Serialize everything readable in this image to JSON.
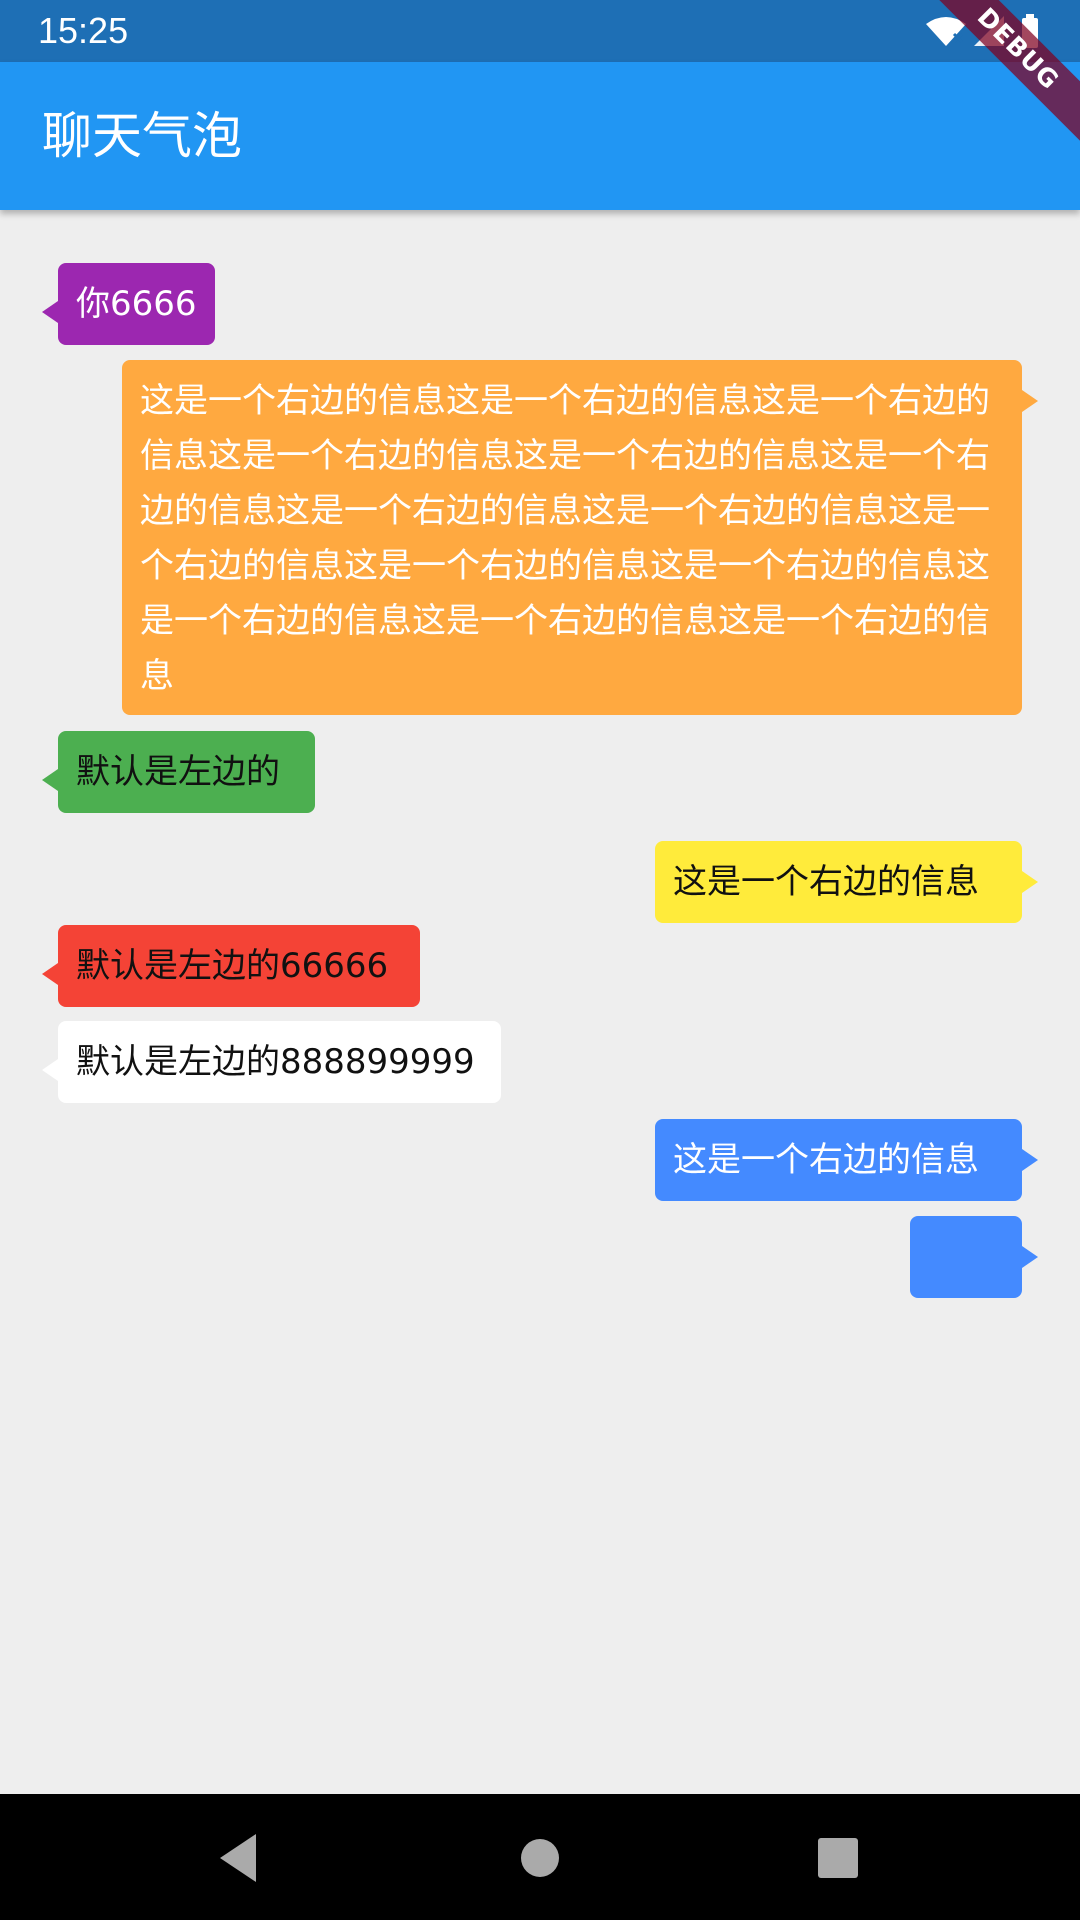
{
  "status_bar": {
    "time": "15:25",
    "icons": [
      "wifi-icon",
      "signal-icon",
      "battery-icon"
    ]
  },
  "app_bar": {
    "title": "聊天气泡",
    "debug_banner": "DEBUG",
    "color": "#2196f3"
  },
  "messages": [
    {
      "side": "left",
      "text": "你6666",
      "color": "#9c27b0",
      "text_color": "#ffffff"
    },
    {
      "side": "right",
      "text": "这是一个右边的信息这是一个右边的信息这是一个右边的信息这是一个右边的信息这是一个右边的信息这是一个右边的信息这是一个右边的信息这是一个右边的信息这是一个右边的信息这是一个右边的信息这是一个右边的信息这是一个右边的信息这是一个右边的信息这是一个右边的信息",
      "color": "#ffa940",
      "text_color": "#ffffff"
    },
    {
      "side": "left",
      "text": "默认是左边的",
      "color": "#4caf50",
      "text_color": "#111111"
    },
    {
      "side": "right",
      "text": "这是一个右边的信息",
      "color": "#ffeb3b",
      "text_color": "#111111"
    },
    {
      "side": "left",
      "text": "默认是左边的66666",
      "color": "#f44336",
      "text_color": "#111111"
    },
    {
      "side": "left",
      "text": "默认是左边的888899999",
      "color": "#ffffff",
      "text_color": "#111111"
    },
    {
      "side": "right",
      "text": "这是一个右边的信息",
      "color": "#448aff",
      "text_color": "#ffffff"
    },
    {
      "side": "right",
      "text": "",
      "color": "#448aff",
      "text_color": "#ffffff"
    }
  ],
  "nav_bar": {
    "buttons": [
      "back-icon",
      "home-icon",
      "recents-icon"
    ]
  }
}
